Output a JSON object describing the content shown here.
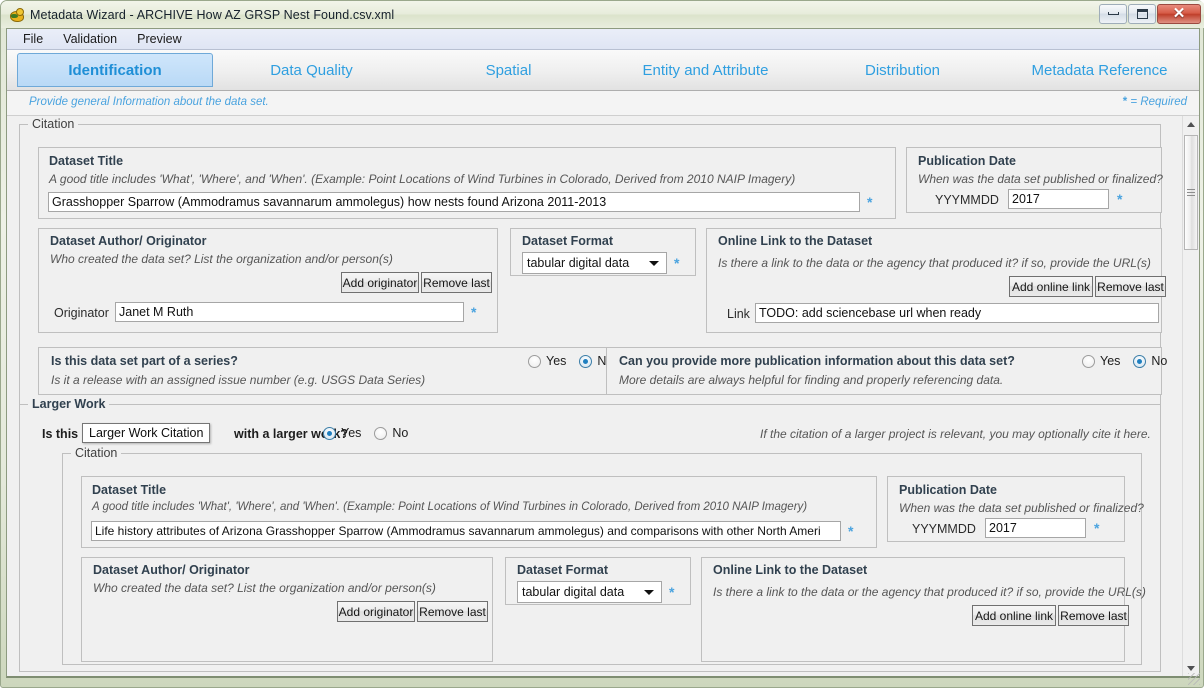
{
  "window": {
    "title": "Metadata Wizard - ARCHIVE How AZ GRSP Nest Found.csv.xml",
    "icon": "bird-icon",
    "minimize_label": "",
    "maximize_label": "",
    "close_label": "✕"
  },
  "menubar": {
    "items": [
      {
        "label": "File"
      },
      {
        "label": "Validation"
      },
      {
        "label": "Preview"
      }
    ]
  },
  "tabs": [
    {
      "label": "Identification",
      "active": true
    },
    {
      "label": "Data Quality",
      "active": false
    },
    {
      "label": "Spatial",
      "active": false
    },
    {
      "label": "Entity and Attribute",
      "active": false
    },
    {
      "label": "Distribution",
      "active": false
    },
    {
      "label": "Metadata Reference",
      "active": false
    }
  ],
  "hintbar": {
    "hint": "Provide general Information about the data set.",
    "required_star": "*",
    "required_text": " = Required"
  },
  "citation": {
    "legend": "Citation",
    "dataset_title": {
      "title": "Dataset Title",
      "hint": "A good title includes 'What', 'Where', and 'When'.  (Example: Point Locations of Wind Turbines in Colorado, Derived from 2010 NAIP Imagery)",
      "value": "Grasshopper Sparrow (Ammodramus savannarum ammolegus) how nests found Arizona 2011-2013",
      "required": "*"
    },
    "publication_date": {
      "title": "Publication Date",
      "hint": "When was the data set published or finalized?",
      "field_label": "YYYMMDD",
      "value": "2017",
      "required": "*"
    },
    "author": {
      "title": "Dataset Author/ Originator",
      "hint": "Who created the data set? List the organization and/or person(s)",
      "add_label": "Add originator",
      "remove_label": "Remove last",
      "field_label": "Originator",
      "value": "Janet M Ruth",
      "required": "*"
    },
    "format": {
      "title": "Dataset Format",
      "value": "tabular digital data",
      "required": "*",
      "options": [
        "tabular digital data"
      ]
    },
    "online_link": {
      "title": "Online Link to the Dataset",
      "hint": "Is there a link to the data or the agency that produced it? if so, provide the URL(s)",
      "add_label": "Add online link",
      "remove_label": "Remove last",
      "field_label": "Link",
      "value": "TODO: add sciencebase url when ready"
    }
  },
  "series_question": {
    "question": "Is this data set part of a series?",
    "hint": "Is it a release with an assigned issue number (e.g. USGS Data Series)",
    "yes_label": "Yes",
    "no_label": "No",
    "selected": "No"
  },
  "publication_question": {
    "question": "Can you provide more publication information about this data set?",
    "hint": "More details are always helpful for finding and properly referencing data.",
    "yes_label": "Yes",
    "no_label": "No",
    "selected": "No"
  },
  "larger_work": {
    "legend": "Larger Work",
    "question_prefix": "Is this",
    "question_suffix": "with a larger work?",
    "yes_label": "Yes",
    "no_label": "No",
    "selected": "Yes",
    "tooltip": "Larger Work Citation",
    "side_hint": "If the citation of a larger project is relevant, you may optionally cite it here.",
    "citation": {
      "legend": "Citation",
      "dataset_title": {
        "title": "Dataset Title",
        "hint": "A good title includes 'What', 'Where', and 'When'.  (Example: Point Locations of Wind Turbines in Colorado, Derived from 2010 NAIP Imagery)",
        "value": "Life history attributes of Arizona Grasshopper Sparrow (Ammodramus savannarum ammolegus) and comparisons with other North Ameri",
        "required": "*"
      },
      "publication_date": {
        "title": "Publication Date",
        "hint": "When was the data set published or finalized?",
        "field_label": "YYYMMDD",
        "value": "2017",
        "required": "*"
      },
      "author": {
        "title": "Dataset Author/ Originator",
        "hint": "Who created the data set? List the organization and/or person(s)",
        "add_label": "Add originator",
        "remove_label": "Remove last"
      },
      "format": {
        "title": "Dataset Format",
        "value": "tabular digital data",
        "required": "*"
      },
      "online_link": {
        "title": "Online Link to the Dataset",
        "hint": "Is there a link to the data or the agency that produced it? if so, provide the URL(s)",
        "add_label": "Add online link",
        "remove_label": "Remove last"
      }
    }
  },
  "colors": {
    "accent": "#4aa3df",
    "tab_text": "#2f9fe0",
    "tab_active_bg": "#c2ddf7",
    "panel_bg": "#f0f0f0",
    "frame": "#dfe6d4"
  }
}
